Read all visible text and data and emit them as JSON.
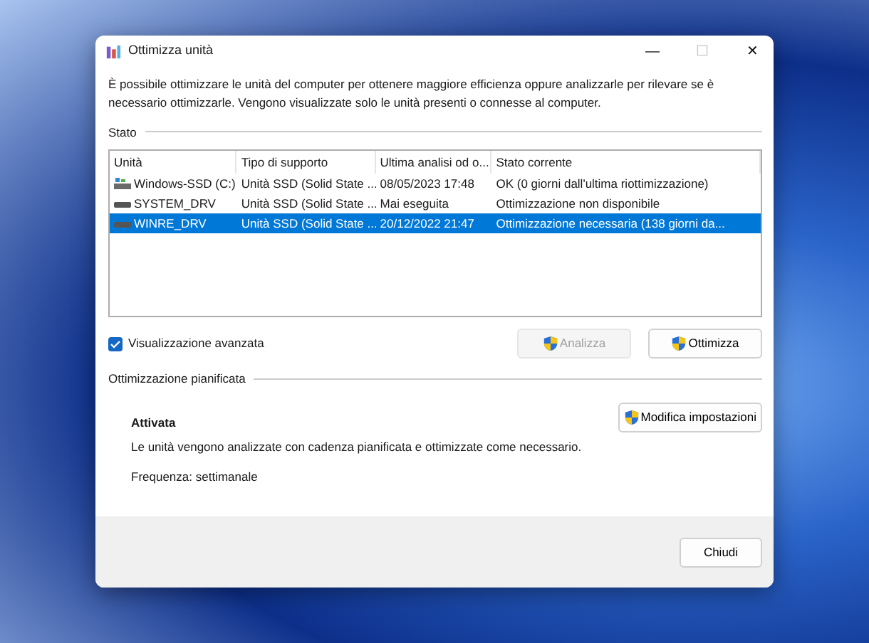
{
  "window": {
    "title": "Ottimizza unità",
    "controls": [
      {
        "glyph": "—",
        "disabled": false
      },
      {
        "glyph": "☐",
        "disabled": true
      },
      {
        "glyph": "✕",
        "disabled": false
      }
    ]
  },
  "description": "È possibile ottimizzare le unità del computer per ottenere maggiore efficienza oppure analizzarle per rilevare se è necessario ottimizzarle. Vengono visualizzate solo le unità presenti o connesse al computer.",
  "status_section": {
    "label": "Stato"
  },
  "table": {
    "columns": [
      "Unità",
      "Tipo di supporto",
      "Ultima analisi od o...",
      "Stato corrente"
    ],
    "rows": [
      {
        "kind": "system",
        "cells": [
          "Windows-SSD (C:)",
          "Unità SSD (Solid State ...",
          "08/05/2023 17:48",
          "OK (0 giorni dall'ultima riottimizzazione)"
        ],
        "selected": false
      },
      {
        "kind": "plain",
        "cells": [
          "SYSTEM_DRV",
          "Unità SSD (Solid State ...",
          "Mai eseguita",
          "Ottimizzazione non disponibile"
        ],
        "selected": false
      },
      {
        "kind": "plain",
        "cells": [
          "WINRE_DRV",
          "Unità SSD (Solid State ...",
          "20/12/2022 21:47",
          "Ottimizzazione necessaria (138 giorni da..."
        ],
        "selected": true
      }
    ]
  },
  "advanced_view": {
    "label": "Visualizzazione avanzata",
    "checked": true
  },
  "actions": [
    {
      "label": "Analizza",
      "disabled": true
    },
    {
      "label": "Ottimizza",
      "disabled": false
    }
  ],
  "scheduled_section": {
    "label": "Ottimizzazione pianificata",
    "state": "Attivata",
    "description": "Le unità vengono analizzate con cadenza pianificata e ottimizzate come necessario.",
    "frequency": "Frequenza: settimanale",
    "button": "Modifica impostazioni"
  },
  "footer": {
    "button": "Chiudi"
  }
}
